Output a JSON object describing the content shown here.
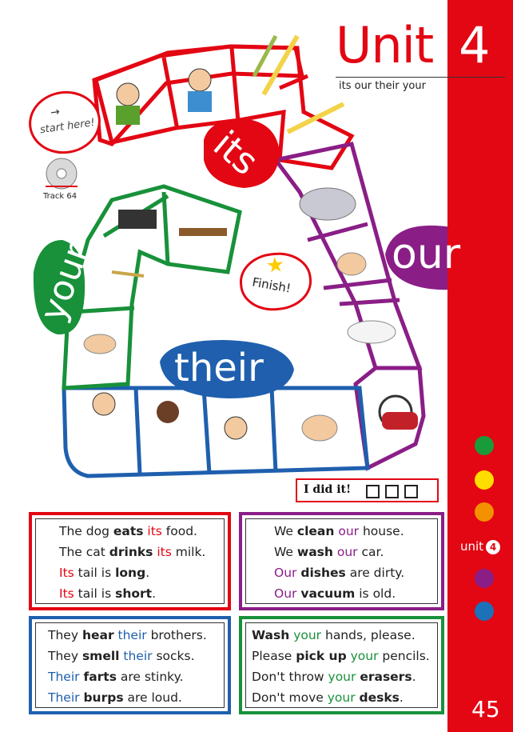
{
  "header": {
    "unit_word": "Unit",
    "unit_number": "4",
    "subtitle": "its our their your"
  },
  "board": {
    "start_label": "start here!",
    "track_label": "Track 64",
    "finish_label": "Finish!",
    "words": {
      "its": "its",
      "our": "our",
      "your": "your",
      "their": "their"
    },
    "did_it_label": "I did it!"
  },
  "colors": {
    "red": "#e30613",
    "purple": "#8a1e86",
    "blue": "#1f5fae",
    "green": "#18913a",
    "side_dots": [
      "#1a9b3a",
      "#ffdd00",
      "#f39200",
      "#8a1e86",
      "#1d71b8"
    ]
  },
  "sentences": {
    "its": {
      "lines": [
        [
          {
            "t": "The dog "
          },
          {
            "t": "eats",
            "b": true
          },
          {
            "t": " "
          },
          {
            "t": "its",
            "c": "red"
          },
          {
            "t": " food."
          }
        ],
        [
          {
            "t": "The cat "
          },
          {
            "t": "drinks",
            "b": true
          },
          {
            "t": " "
          },
          {
            "t": "its",
            "c": "red"
          },
          {
            "t": " milk."
          }
        ],
        [
          {
            "t": "Its",
            "c": "red"
          },
          {
            "t": " tail is "
          },
          {
            "t": "long",
            "b": true
          },
          {
            "t": "."
          }
        ],
        [
          {
            "t": "Its",
            "c": "red"
          },
          {
            "t": " tail is "
          },
          {
            "t": "short",
            "b": true
          },
          {
            "t": "."
          }
        ]
      ]
    },
    "our": {
      "lines": [
        [
          {
            "t": "We "
          },
          {
            "t": "clean",
            "b": true
          },
          {
            "t": " "
          },
          {
            "t": "our",
            "c": "purple"
          },
          {
            "t": " house."
          }
        ],
        [
          {
            "t": "We "
          },
          {
            "t": "wash",
            "b": true
          },
          {
            "t": " "
          },
          {
            "t": "our",
            "c": "purple"
          },
          {
            "t": " car."
          }
        ],
        [
          {
            "t": "Our",
            "c": "purple"
          },
          {
            "t": " "
          },
          {
            "t": "dishes",
            "b": true
          },
          {
            "t": " are dirty."
          }
        ],
        [
          {
            "t": "Our",
            "c": "purple"
          },
          {
            "t": " "
          },
          {
            "t": "vacuum",
            "b": true
          },
          {
            "t": " is old."
          }
        ]
      ]
    },
    "their": {
      "lines": [
        [
          {
            "t": "They "
          },
          {
            "t": "hear",
            "b": true
          },
          {
            "t": " "
          },
          {
            "t": "their",
            "c": "blue"
          },
          {
            "t": " brothers."
          }
        ],
        [
          {
            "t": "They "
          },
          {
            "t": "smell",
            "b": true
          },
          {
            "t": " "
          },
          {
            "t": "their",
            "c": "blue"
          },
          {
            "t": " socks."
          }
        ],
        [
          {
            "t": "Their",
            "c": "blue"
          },
          {
            "t": " "
          },
          {
            "t": "farts",
            "b": true
          },
          {
            "t": " are stinky."
          }
        ],
        [
          {
            "t": "Their",
            "c": "blue"
          },
          {
            "t": " "
          },
          {
            "t": "burps",
            "b": true
          },
          {
            "t": " are loud."
          }
        ]
      ]
    },
    "your": {
      "lines": [
        [
          {
            "t": "Wash",
            "b": true
          },
          {
            "t": " "
          },
          {
            "t": "your",
            "c": "green"
          },
          {
            "t": " hands, please."
          }
        ],
        [
          {
            "t": "Please "
          },
          {
            "t": "pick up",
            "b": true
          },
          {
            "t": " "
          },
          {
            "t": "your",
            "c": "green"
          },
          {
            "t": " pencils."
          }
        ],
        [
          {
            "t": "Don't throw "
          },
          {
            "t": "your",
            "c": "green"
          },
          {
            "t": " "
          },
          {
            "t": "erasers",
            "b": true
          },
          {
            "t": "."
          }
        ],
        [
          {
            "t": "Don't move "
          },
          {
            "t": "your",
            "c": "green"
          },
          {
            "t": " "
          },
          {
            "t": "desks",
            "b": true
          },
          {
            "t": "."
          }
        ]
      ]
    }
  },
  "sidebar": {
    "unit_label": "unit",
    "unit_badge": "4",
    "page_number": "45"
  }
}
